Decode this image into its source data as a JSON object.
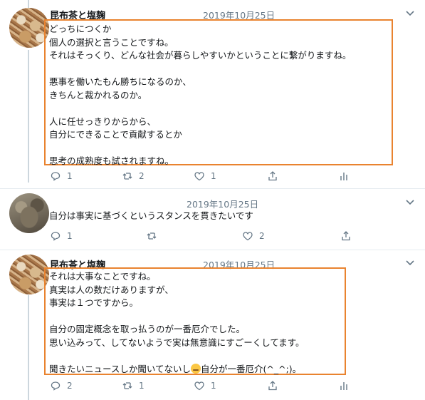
{
  "tweets": [
    {
      "author": "昆布茶と塩麹",
      "date": "2019年10月25日",
      "lines": [
        "どっちにつくか",
        "個人の選択と言うことですね。",
        "それはそっくり、どんな社会が暮らしやすいかということに繋がりますね。",
        "",
        "悪事を働いたもん勝ちになるのか、",
        "きちんと裁かれるのか。",
        "",
        "人に任せっきりからから、",
        "自分にできることで貢献するとか",
        "",
        "思考の成熟度も試されますね。"
      ],
      "actions": {
        "reply_count": "1",
        "retweet_count": "2",
        "like_count": "1"
      }
    },
    {
      "author": "",
      "date": "2019年10月25日",
      "lines": [
        "自分は事実に基づくというスタンスを貫きたいです"
      ],
      "actions": {
        "reply_count": "1",
        "retweet_count": "",
        "like_count": "2"
      }
    },
    {
      "author": "昆布茶と塩麹",
      "date": "2019年10月25日",
      "lines": [
        "それは大事なことですね。",
        "真実は人の数だけありますが、",
        "事実は１つですから。",
        "",
        "自分の固定概念を取っ払うのが一番厄介でした。",
        "思い込みって、してないようで実は無意識にすごーくしてます。",
        "",
        "聞きたいニュースしか聞いてないし",
        "自分が一番厄介(^_^;)。"
      ],
      "emoji_name": "sweat-smile-emoji",
      "actions": {
        "reply_count": "2",
        "retweet_count": "1",
        "like_count": "1"
      }
    }
  ],
  "colors": {
    "highlight": "#e9832f",
    "thread_line": "#ccd6dd",
    "muted_text": "#657786"
  },
  "icons": [
    "reply-icon",
    "retweet-icon",
    "like-icon",
    "share-icon",
    "analytics-icon",
    "chevron-down-icon"
  ]
}
